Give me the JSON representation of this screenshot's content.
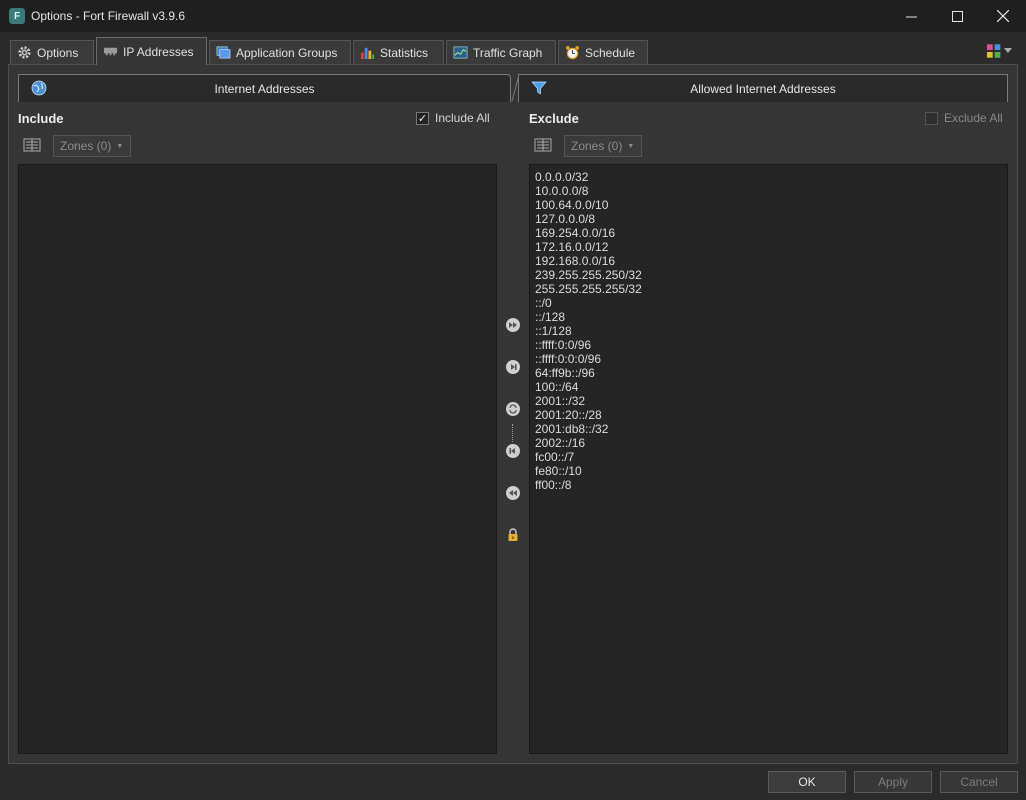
{
  "window": {
    "title": "Options - Fort Firewall v3.9.6"
  },
  "tabs": [
    {
      "label": "Options",
      "icon": "gear-icon"
    },
    {
      "label": "IP Addresses",
      "icon": "network-card-icon"
    },
    {
      "label": "Application Groups",
      "icon": "window-group-icon"
    },
    {
      "label": "Statistics",
      "icon": "bar-chart-icon"
    },
    {
      "label": "Traffic Graph",
      "icon": "graph-icon"
    },
    {
      "label": "Schedule",
      "icon": "alarm-clock-icon"
    }
  ],
  "headers": {
    "left": "Internet Addresses",
    "right": "Allowed Internet Addresses"
  },
  "include": {
    "title": "Include",
    "checkbox_label": "Include All",
    "checked": true,
    "zones_label": "Zones (0)",
    "addresses": []
  },
  "exclude": {
    "title": "Exclude",
    "checkbox_label": "Exclude All",
    "checked": false,
    "zones_label": "Zones (0)",
    "addresses": [
      "0.0.0.0/32",
      "10.0.0.0/8",
      "100.64.0.0/10",
      "127.0.0.0/8",
      "169.254.0.0/16",
      "172.16.0.0/12",
      "192.168.0.0/16",
      "239.255.255.250/32",
      "255.255.255.255/32",
      "::/0",
      "::/128",
      "::1/128",
      "::ffff:0:0/96",
      "::ffff:0:0:0/96",
      "64:ff9b::/96",
      "100::/64",
      "2001::/32",
      "2001:20::/28",
      "2001:db8::/32",
      "2002::/16",
      "fc00::/7",
      "fe80::/10",
      "ff00::/8"
    ]
  },
  "buttons": {
    "ok": "OK",
    "apply": "Apply",
    "cancel": "Cancel"
  }
}
